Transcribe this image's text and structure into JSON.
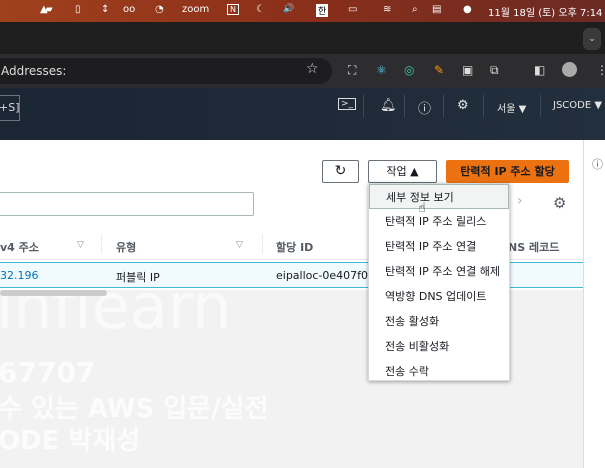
{
  "menubar": {
    "icons": [
      "vlc-icon",
      "pen-icon",
      "phone-icon",
      "arrows-icon",
      "glasses-icon",
      "chat-icon"
    ],
    "zoom": "zoom",
    "notion": "N",
    "moon": "☾",
    "volume": "🔊",
    "input_lang": "한",
    "battery": "battery-icon",
    "datetime": "11월 18일 (토) 오후 7:14"
  },
  "browser": {
    "address": "Addresses:",
    "tab_menu": "⌄"
  },
  "aws_nav": {
    "shortcut": "+S]",
    "region": "서울 ▼",
    "account": "JSCODE ▼"
  },
  "toolbar": {
    "refresh": "↻",
    "actions": "작업 ▲",
    "allocate": "탄력적 IP 주소 할당"
  },
  "table": {
    "headers": [
      "v4 주소",
      "유형",
      "할당 ID",
      "NS 레코드"
    ],
    "row": {
      "ip": "32.196",
      "type": "퍼블릭 IP",
      "alloc_id": "eipalloc-0e407f00"
    }
  },
  "menu": {
    "items": [
      "세부 정보 보기",
      "탄력적 IP 주소 릴리스",
      "탄력적 IP 주소 연결",
      "탄력적 IP 주소 연결 해제",
      "역방향 DNS 업데이트",
      "전송 활성화",
      "전송 비활성화",
      "전송 수락"
    ]
  },
  "watermark": {
    "logo": "inflearn",
    "line1": "67707",
    "line2": "수 있는 AWS 입문/실전",
    "line3": "ODE 박재성"
  },
  "colors": {
    "accent": "#ec7211",
    "nav": "#232f3e",
    "link": "#0073bb",
    "selected_row": "#f1faff"
  }
}
